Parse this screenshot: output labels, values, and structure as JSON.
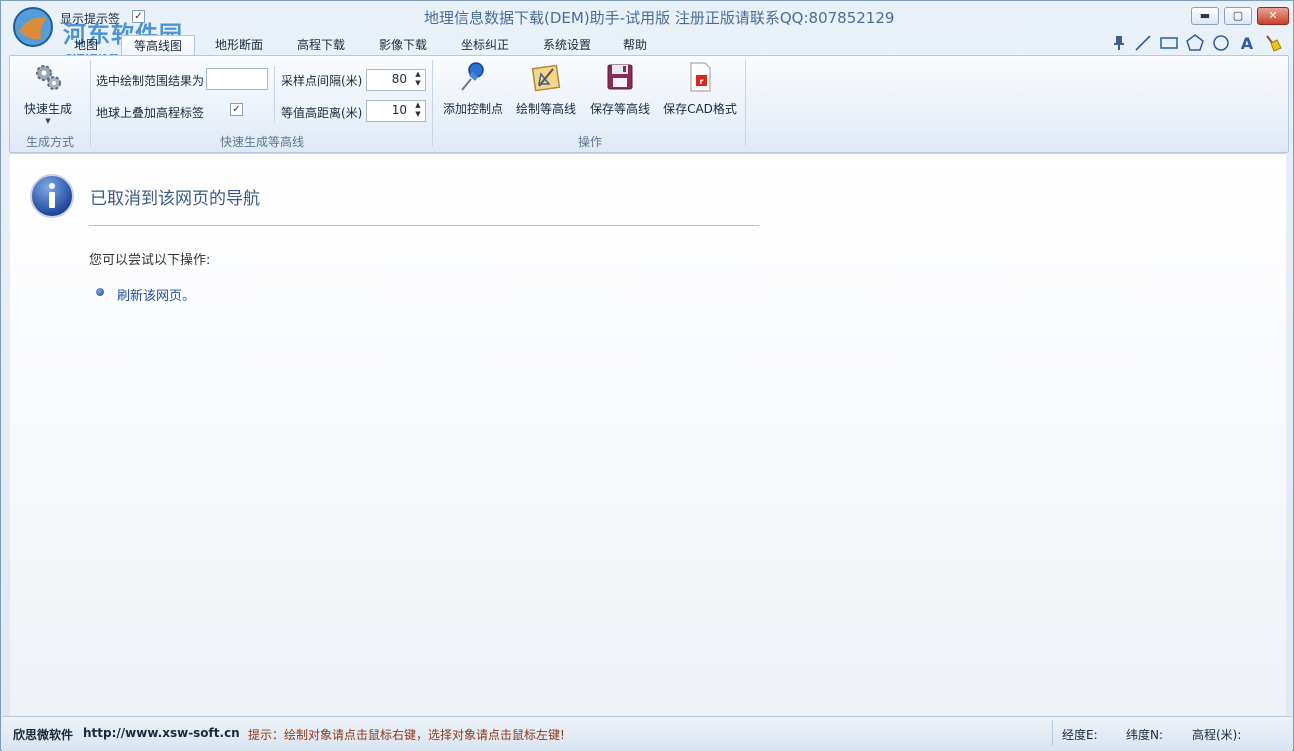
{
  "window": {
    "title": "地理信息数据下载(DEM)助手-试用版     注册正版请联系QQ:807852129",
    "watermark_name": "河东软件园",
    "watermark_url": "www.pc0359.cn",
    "show_tip_label": "显示提示签",
    "show_tip_checked": "✓",
    "min_glyph": "▬",
    "max_glyph": "▢",
    "close_glyph": "✕"
  },
  "tabs": [
    "地图",
    "等高线图",
    "地形断面",
    "高程下载",
    "影像下载",
    "坐标纠正",
    "系统设置",
    "帮助"
  ],
  "toolbar_icons": [
    "pin-icon",
    "line-icon",
    "rectangle-icon",
    "pentagon-icon",
    "circle-icon",
    "text-icon",
    "broom-icon"
  ],
  "ribbon": {
    "generate": {
      "label": "快速生成",
      "caption": "生成方式"
    },
    "quick_group": {
      "caption": "快速生成等高线",
      "select_range_label": "选中绘制范围结果为",
      "overlay_label": "地球上叠加高程标签",
      "overlay_checked": "✓",
      "sample_interval_label": "采样点间隔(米)",
      "sample_interval_value": "80",
      "contour_interval_label": "等值高距离(米)",
      "contour_interval_value": "10"
    },
    "ops_group": {
      "caption": "操作",
      "add_control_point": "添加控制点",
      "draw_contour": "绘制等高线",
      "save_contour": "保存等高线",
      "save_cad": "保存CAD格式"
    }
  },
  "content": {
    "title": "已取消到该网页的导航",
    "try_text": "您可以尝试以下操作:",
    "refresh_link": "刷新该网页。"
  },
  "status": {
    "company": "欣思微软件",
    "url": "http://www.xsw-soft.cn",
    "hint": "提示：绘制对象请点击鼠标右键，选择对象请点击鼠标左键!",
    "lon_label": "经度E:",
    "lat_label": "纬度N:",
    "elev_label": "高程(米):"
  },
  "colors": {
    "accent": "#4a6d97",
    "link": "#1f4f9a",
    "hint": "#8b3a1a"
  }
}
